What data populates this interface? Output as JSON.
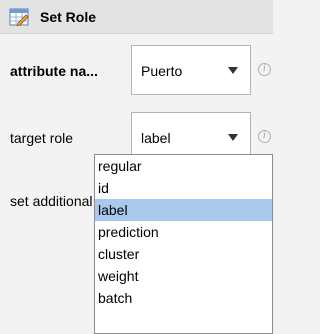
{
  "header": {
    "title": "Set Role",
    "icon": "set-role-icon"
  },
  "fields": {
    "attribute_name": {
      "label": "attribute na...",
      "value": "Puerto"
    },
    "target_role": {
      "label": "target role",
      "value": "label"
    },
    "set_additional": {
      "label": "set additional roles"
    }
  },
  "dropdown": {
    "selected": "label",
    "options": [
      "regular",
      "id",
      "label",
      "prediction",
      "cluster",
      "weight",
      "batch"
    ]
  },
  "colors": {
    "selection": "#a8c8ec",
    "header_bg": "#e3e3e3"
  }
}
